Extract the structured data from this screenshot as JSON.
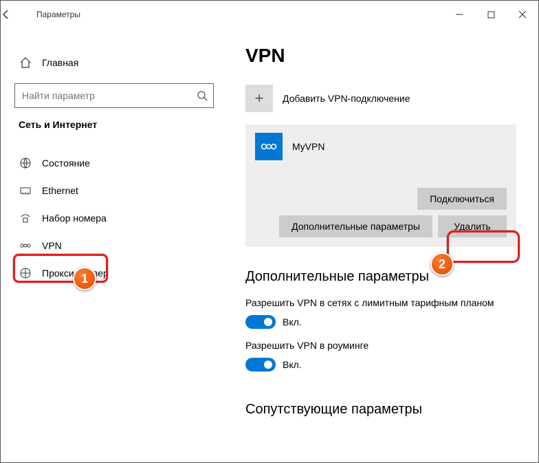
{
  "window": {
    "title": "Параметры"
  },
  "sidebar": {
    "home": "Главная",
    "search_placeholder": "Найти параметр",
    "category": "Сеть и Интернет",
    "items": [
      {
        "label": "Состояние"
      },
      {
        "label": "Ethernet"
      },
      {
        "label": "Набор номера"
      },
      {
        "label": "VPN"
      },
      {
        "label": "Прокси-сервер"
      }
    ]
  },
  "page": {
    "title": "VPN",
    "add_label": "Добавить VPN-подключение",
    "connection": {
      "name": "MyVPN",
      "connect_btn": "Подключиться",
      "advanced_btn": "Дополнительные параметры",
      "delete_btn": "Удалить"
    },
    "section_advanced": "Дополнительные параметры",
    "setting1": {
      "label": "Разрешить VPN в сетях с лимитным тарифным планом",
      "state": "Вкл."
    },
    "setting2": {
      "label": "Разрешить VPN в роуминге",
      "state": "Вкл."
    },
    "section_related": "Сопутствующие параметры"
  },
  "callouts": {
    "one": "1",
    "two": "2"
  }
}
